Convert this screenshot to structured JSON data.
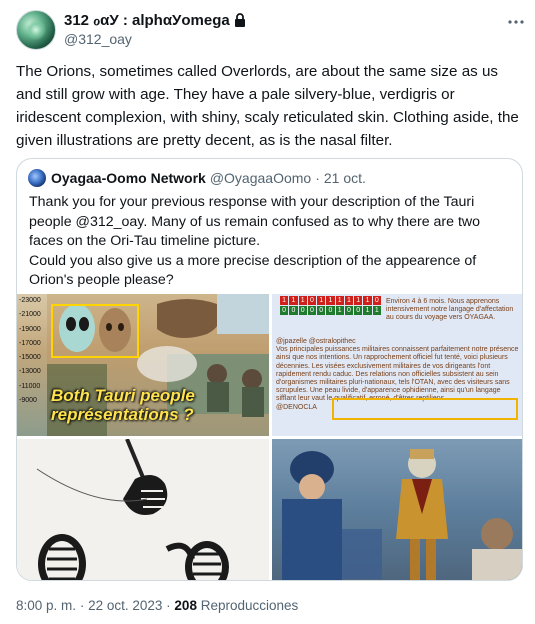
{
  "author": {
    "display_name": "312 ℴαУ : alphαУomega",
    "handle": "@312_oay",
    "locked": true
  },
  "tweet": {
    "text": "The Orions, sometimes called Overlords, are about the same size as us and still grow with age. They have a pale silvery-blue, verdigris or iridescent complexion, with shiny, scaly reticulated skin. Clothing aside, the given illustrations are pretty decent, as is the nasal filter."
  },
  "quote": {
    "author_name": "Oyagaa-Oomo Network",
    "author_handle": "@OyagaaOomo",
    "separator": "·",
    "date": "21 oct.",
    "text_line1": "Thank you for your previous response with your description of the Tauri people @312_oay. Many of us remain confused as to why there are two faces on the Ori-Tau timeline picture.",
    "text_line2": "Could you also give us a more precise description of the appearence of Orion's people please?",
    "images": {
      "img1": {
        "scale_labels": [
          "-23000",
          "-21000",
          "-19000",
          "-17000",
          "-15000",
          "-13000",
          "-11000",
          "-9000"
        ],
        "caption_line1": "Both Tauri people",
        "caption_line2": "représentations ?"
      },
      "img2": {
        "binary_row1": [
          "1",
          "1",
          "1",
          "0",
          "1",
          "1",
          "1",
          "1",
          "1",
          "1",
          "0"
        ],
        "binary_row2": [
          "0",
          "0",
          "0",
          "0",
          "0",
          "0",
          "1",
          "0",
          "0",
          "1",
          "1"
        ],
        "top_text": "Environ 4 à 6 mois. Nous apprenons intensivement notre langage d'affectation au cours du voyage vers OYAGAA.",
        "mention": "@jpazelle @ostralopithec",
        "body_text": "Vos principales puissances militaires connaissent parfaitement notre présence ainsi que nos intentions. Un rapprochement officiel fut tenté, voici plusieurs décennies. Les visées exclusivement militaires de vos dirigeants l'ont rapidement rendu caduc. Des relations non officielles subsistent au sein d'organismes militaires pluri-nationaux, tels l'OTAN, avec des visiteurs sans scrupules. Une peau livide, d'apparence ophidienne, ainsi qu'un langage sifflant leur vaut le qualificatif, erroné, d'êtres reptiliens.",
        "footer_tag": "@DENOCLA"
      }
    }
  },
  "footer": {
    "time": "8:00 p. m.",
    "separator1": "·",
    "date": "22 oct. 2023",
    "separator2": "·",
    "views_count": "208",
    "views_label": "Reproducciones"
  },
  "colors": {
    "text_primary": "#0f1419",
    "text_secondary": "#536471",
    "border": "#cfd9de",
    "img_caption_yellow": "#ffe34d",
    "binary_red": "#d0201c",
    "binary_green": "#1f7a2e"
  },
  "icons": [
    "lock-icon",
    "more-horizontal-icon"
  ]
}
